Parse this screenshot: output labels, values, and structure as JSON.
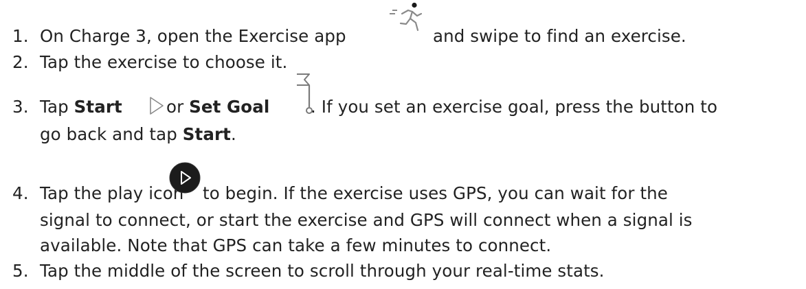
{
  "steps": [
    {
      "num": "1.",
      "parts": [
        "On Charge 3, open the Exercise app ",
        " and swipe to find an exercise."
      ],
      "icon": "running-person-icon"
    },
    {
      "num": "2.",
      "text": "Tap the exercise to choose it."
    },
    {
      "num": "3.",
      "t1": "Tap ",
      "bold1": "Start",
      "t2": " or ",
      "bold2": "Set Goal",
      "t3": ". If you set an exercise goal, press the button to",
      "l2a": "go back and tap ",
      "l2bold": "Start",
      "l2b": ".",
      "icons": [
        "play-outline-icon",
        "goal-flag-icon"
      ]
    },
    {
      "num": "4.",
      "t1": "Tap the play icon ",
      "t2": " to begin. If the exercise uses GPS, you can wait for the",
      "l2": "signal to connect, or start the exercise and GPS will connect when a signal is",
      "l3": "available. Note that GPS can take a few minutes to connect.",
      "icon": "play-button-icon"
    },
    {
      "num": "5.",
      "text": "Tap the middle of the screen to scroll through your real-time stats."
    }
  ],
  "colors": {
    "text": "#222222",
    "icon_dark": "#1a1a1a",
    "icon_gray": "#8a8a8a"
  }
}
